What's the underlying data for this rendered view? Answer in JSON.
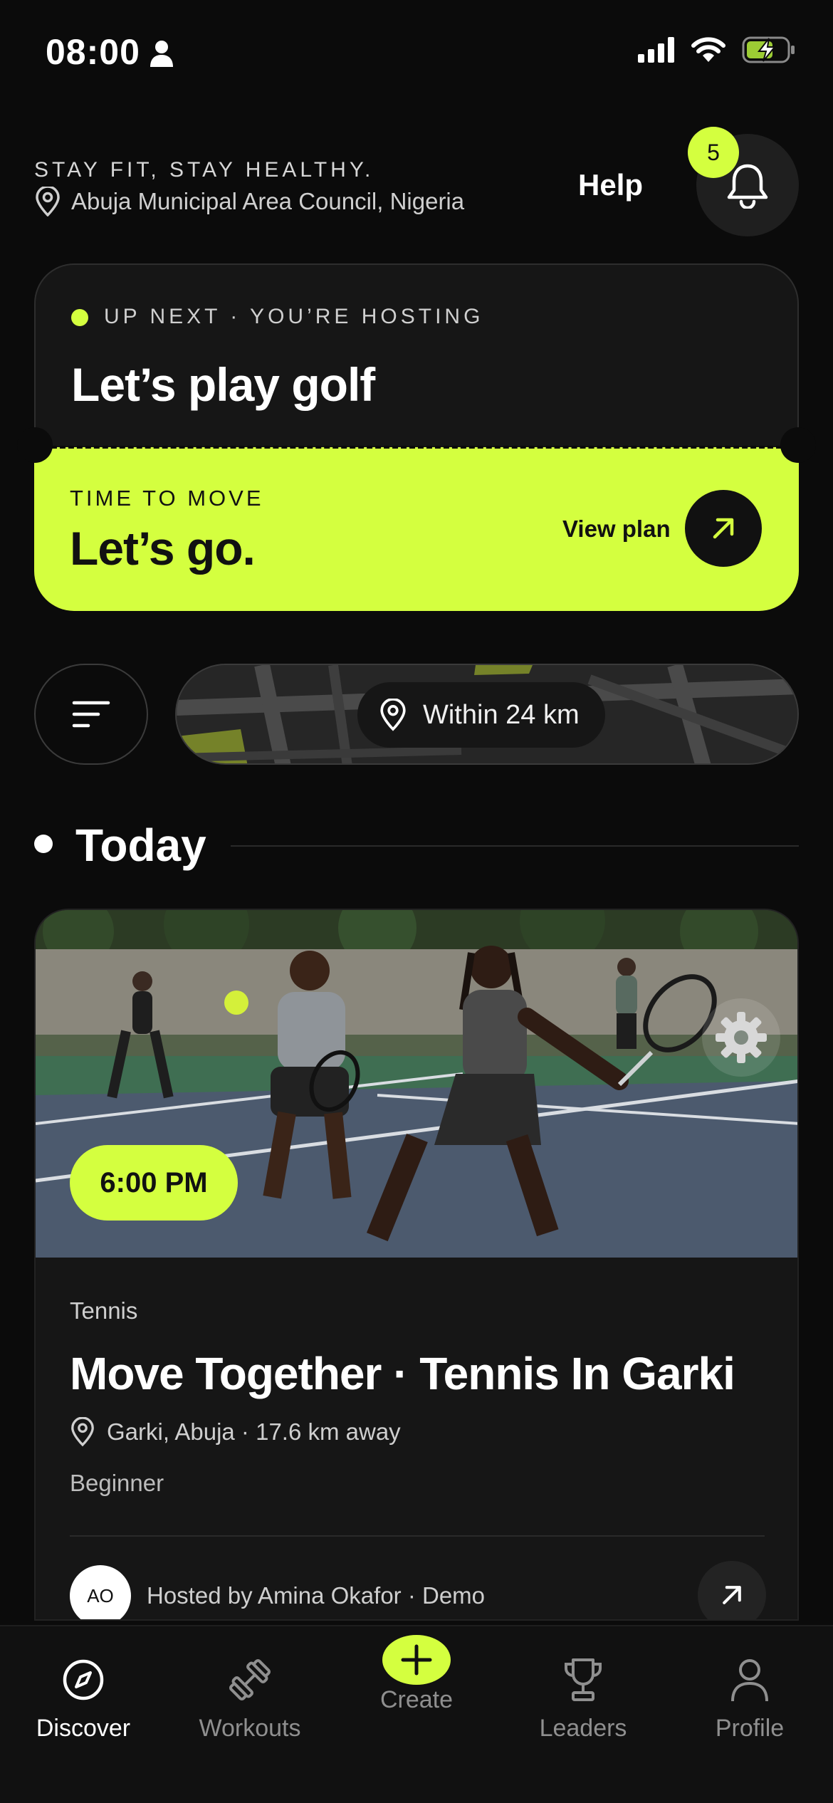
{
  "status_bar": {
    "time": "08:00"
  },
  "header": {
    "tagline": "STAY FIT, STAY HEALTHY.",
    "location": "Abuja Municipal Area Council, Nigeria",
    "help_label": "Help",
    "notification_count": "5"
  },
  "up_next": {
    "eyebrow": "UP NEXT · YOU’RE HOSTING",
    "title": "Let’s play golf",
    "cta_eyebrow": "TIME TO MOVE",
    "cta_title": "Let’s go.",
    "view_plan_label": "View plan"
  },
  "filters": {
    "distance_label": "Within 24 km"
  },
  "section": {
    "title": "Today"
  },
  "event": {
    "time": "6:00 PM",
    "sport": "Tennis",
    "title": "Move Together · Tennis In Garki",
    "location": "Garki, Abuja · 17.6 km away",
    "level": "Beginner",
    "host_initials": "AO",
    "hosted_by": "Hosted by Amina Okafor · Demo"
  },
  "tabbar": {
    "tabs": [
      {
        "label": "Discover",
        "icon": "compass-icon",
        "active": true
      },
      {
        "label": "Workouts",
        "icon": "dumbbell-icon",
        "active": false
      },
      {
        "label": "Create",
        "icon": "plus-icon",
        "active": false
      },
      {
        "label": "Leaders",
        "icon": "trophy-icon",
        "active": false
      },
      {
        "label": "Profile",
        "icon": "person-icon",
        "active": false
      }
    ]
  },
  "colors": {
    "accent": "#d4ff3f",
    "background": "#0b0b0b",
    "card": "#161616"
  }
}
